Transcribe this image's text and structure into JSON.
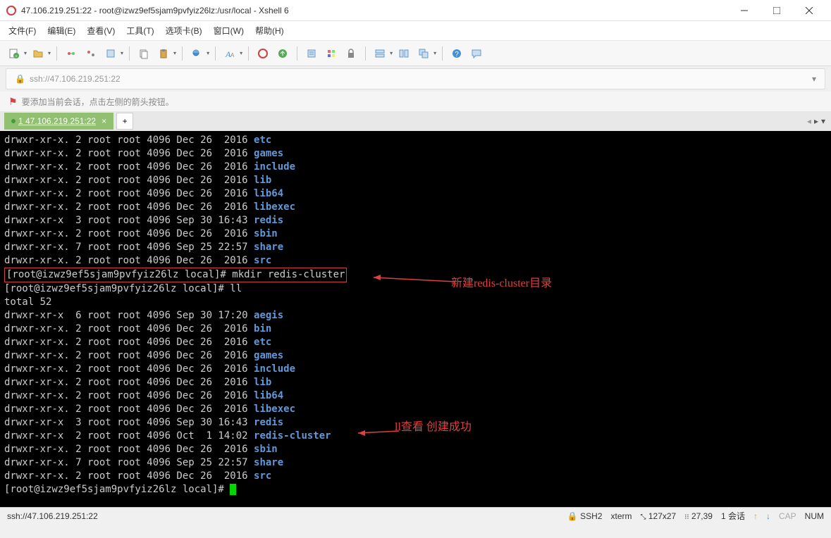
{
  "window_title": "47.106.219.251:22 - root@izwz9ef5sjam9pvfyiz26lz:/usr/local - Xshell 6",
  "menu": [
    "文件(F)",
    "编辑(E)",
    "查看(V)",
    "工具(T)",
    "选项卡(B)",
    "窗口(W)",
    "帮助(H)"
  ],
  "address": "ssh://47.106.219.251:22",
  "hint": "要添加当前会话，点击左侧的箭头按钮。",
  "tab": {
    "label": "1 47.106.219.251:22"
  },
  "terminal": {
    "ls1": [
      {
        "meta": "drwxr-xr-x. 2 root root 4096 Dec 26  2016 ",
        "name": "etc"
      },
      {
        "meta": "drwxr-xr-x. 2 root root 4096 Dec 26  2016 ",
        "name": "games"
      },
      {
        "meta": "drwxr-xr-x. 2 root root 4096 Dec 26  2016 ",
        "name": "include"
      },
      {
        "meta": "drwxr-xr-x. 2 root root 4096 Dec 26  2016 ",
        "name": "lib"
      },
      {
        "meta": "drwxr-xr-x. 2 root root 4096 Dec 26  2016 ",
        "name": "lib64"
      },
      {
        "meta": "drwxr-xr-x. 2 root root 4096 Dec 26  2016 ",
        "name": "libexec"
      },
      {
        "meta": "drwxr-xr-x  3 root root 4096 Sep 30 16:43 ",
        "name": "redis"
      },
      {
        "meta": "drwxr-xr-x. 2 root root 4096 Dec 26  2016 ",
        "name": "sbin"
      },
      {
        "meta": "drwxr-xr-x. 7 root root 4096 Sep 25 22:57 ",
        "name": "share"
      },
      {
        "meta": "drwxr-xr-x. 2 root root 4096 Dec 26  2016 ",
        "name": "src"
      }
    ],
    "cmd1_prompt": "[root@izwz9ef5sjam9pvfyiz26lz local]# ",
    "cmd1": "mkdir redis-cluster",
    "cmd2_prompt": "[root@izwz9ef5sjam9pvfyiz26lz local]# ",
    "cmd2": "ll",
    "total": "total 52",
    "ls2": [
      {
        "meta": "drwxr-xr-x  6 root root 4096 Sep 30 17:20 ",
        "name": "aegis"
      },
      {
        "meta": "drwxr-xr-x. 2 root root 4096 Dec 26  2016 ",
        "name": "bin"
      },
      {
        "meta": "drwxr-xr-x. 2 root root 4096 Dec 26  2016 ",
        "name": "etc"
      },
      {
        "meta": "drwxr-xr-x. 2 root root 4096 Dec 26  2016 ",
        "name": "games"
      },
      {
        "meta": "drwxr-xr-x. 2 root root 4096 Dec 26  2016 ",
        "name": "include"
      },
      {
        "meta": "drwxr-xr-x. 2 root root 4096 Dec 26  2016 ",
        "name": "lib"
      },
      {
        "meta": "drwxr-xr-x. 2 root root 4096 Dec 26  2016 ",
        "name": "lib64"
      },
      {
        "meta": "drwxr-xr-x. 2 root root 4096 Dec 26  2016 ",
        "name": "libexec"
      },
      {
        "meta": "drwxr-xr-x  3 root root 4096 Sep 30 16:43 ",
        "name": "redis"
      },
      {
        "meta": "drwxr-xr-x  2 root root 4096 Oct  1 14:02 ",
        "name": "redis-cluster"
      },
      {
        "meta": "drwxr-xr-x. 2 root root 4096 Dec 26  2016 ",
        "name": "sbin"
      },
      {
        "meta": "drwxr-xr-x. 7 root root 4096 Sep 25 22:57 ",
        "name": "share"
      },
      {
        "meta": "drwxr-xr-x. 2 root root 4096 Dec 26  2016 ",
        "name": "src"
      }
    ],
    "cmd3_prompt": "[root@izwz9ef5sjam9pvfyiz26lz local]# "
  },
  "annotation1": "新建redis-cluster目录",
  "annotation2": "ll查看  创建成功",
  "status": {
    "left": "ssh://47.106.219.251:22",
    "ssh": "SSH2",
    "term": "xterm",
    "size": "127x27",
    "pos": "27,39",
    "sess": "1 会话",
    "cap": "CAP",
    "num": "NUM"
  }
}
